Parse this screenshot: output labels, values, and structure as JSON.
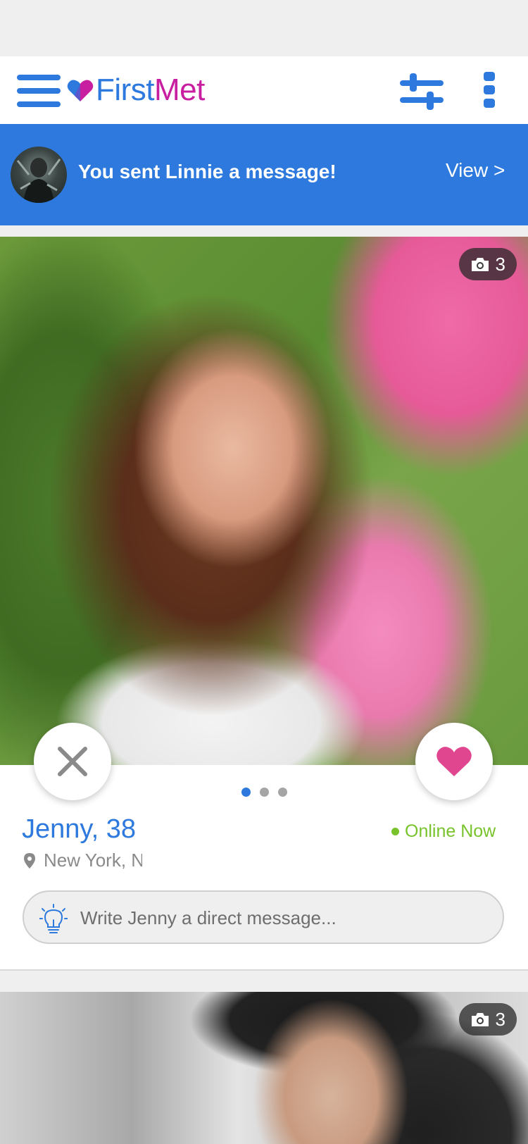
{
  "header": {
    "logo_first": "First",
    "logo_met": "Met"
  },
  "banner": {
    "text": "You sent Linnie a message!",
    "view_label": "View >"
  },
  "profile": {
    "photo_count": "3",
    "name_age": "Jenny, 38",
    "status": "Online Now",
    "location": "New York, NY",
    "message_placeholder": "Write Jenny a direct message...",
    "photo_pages": 3,
    "active_photo_index": 0
  },
  "next_profile": {
    "photo_count": "3"
  },
  "colors": {
    "brand_blue": "#2d79dd",
    "brand_magenta": "#c81ea0",
    "online_green": "#78c32c",
    "like_pink": "#e0468f"
  }
}
